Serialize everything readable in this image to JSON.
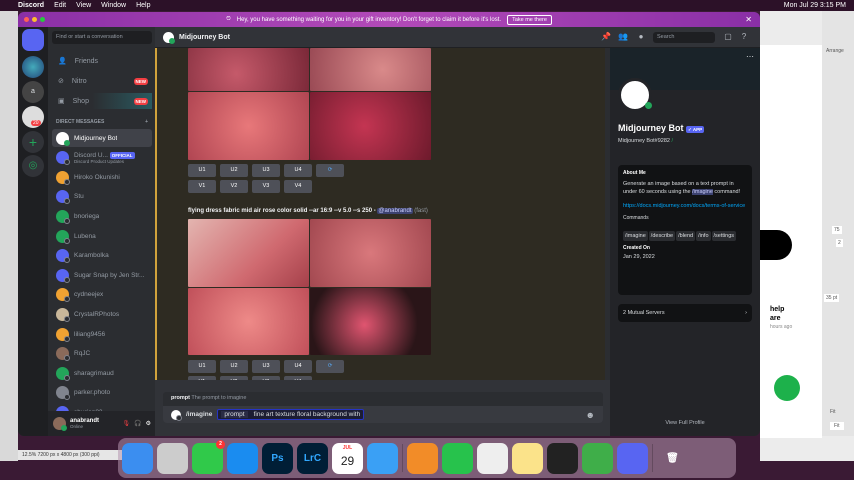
{
  "menubar": {
    "app": "Discord",
    "items": [
      "Edit",
      "View",
      "Window",
      "Help"
    ],
    "clock": "Mon Jul 29  3:15 PM"
  },
  "banner": {
    "text": "Hey, you have something waiting for you in your gift inventory! Don't forget to claim it before it's lost.",
    "button": "Take me there"
  },
  "sidebar": {
    "search_placeholder": "Find or start a conversation",
    "nav": [
      {
        "label": "Friends"
      },
      {
        "label": "Nitro",
        "badge": "NEW"
      },
      {
        "label": "Shop",
        "badge": "NEW"
      }
    ],
    "dm_header": "DIRECT MESSAGES",
    "server_badge": "20",
    "dms": [
      {
        "name": "Midjourney Bot",
        "color": "#ffffff",
        "online": true
      },
      {
        "name": "Discord U...",
        "sub": "Discord Product Updates",
        "badge": "OFFICIAL",
        "color": "#5865f2"
      },
      {
        "name": "Hiroko Okunishi",
        "color": "#f0a232"
      },
      {
        "name": "Stu",
        "color": "#5865f2"
      },
      {
        "name": "bnoriega",
        "color": "#23a55a"
      },
      {
        "name": "Lubena",
        "color": "#23a55a"
      },
      {
        "name": "Karambolka",
        "color": "#5865f2"
      },
      {
        "name": "Sugar Snap by Jen Str...",
        "color": "#5865f2"
      },
      {
        "name": "cydneejex",
        "color": "#f0a232"
      },
      {
        "name": "CrystalRPhotos",
        "color": "#c9b79a"
      },
      {
        "name": "liliang9456",
        "color": "#f0a232"
      },
      {
        "name": "RqJC",
        "color": "#8a6a5a"
      },
      {
        "name": "sharagrimaud",
        "color": "#23a55a"
      },
      {
        "name": "parker.photo",
        "color": "#80848e"
      },
      {
        "name": "shurian82",
        "color": "#5865f2"
      }
    ],
    "user": {
      "name": "anabrandt",
      "status": "Online"
    }
  },
  "header": {
    "title": "Midjourney Bot",
    "search_placeholder": "Search"
  },
  "chat": {
    "buttons_u": [
      "U1",
      "U2",
      "U3",
      "U4"
    ],
    "buttons_v": [
      "V1",
      "V2",
      "V3",
      "V4"
    ],
    "message": {
      "prompt": "flying dress fabric mid air rose color solid --ar 16:9 --v 5.0 --s 250 - ",
      "mention": "@anabrandt",
      "speed": "(fast)"
    }
  },
  "composer": {
    "hint_key": "prompt",
    "hint_text": "The prompt to imagine",
    "command": "/imagine",
    "option": "prompt",
    "value": "fine art texture floral background with"
  },
  "profile": {
    "name": "Midjourney Bot",
    "app_badge": "✓ APP",
    "tag": "Midjourney Bot#9282",
    "slash": "/",
    "about_title": "About Me",
    "about_pre": "Generate an image based on a text prompt in under 60 seconds using the ",
    "about_cmd": "/imagine",
    "about_post": " command!",
    "link": "https://docs.midjourney.com/docs/terms-of-service",
    "commands_title": "Commands",
    "commands": [
      "/imagine",
      "/describe",
      "/blend",
      "/info",
      "/settings"
    ],
    "created_title": "Created On",
    "created": "Jan 29, 2022",
    "mutual": "2 Mutual Servers",
    "full": "View Full Profile"
  },
  "background": {
    "ps_status": "12.5%   7200 px x 4800 px (300 ppi)",
    "right_labels": [
      "Arrange",
      "75",
      "2",
      "35 pt",
      "Fit",
      "Fit"
    ],
    "chat_popup": [
      "help",
      "are",
      "hours ago"
    ]
  },
  "dock": [
    {
      "name": "Finder"
    },
    {
      "name": "Launchpad"
    },
    {
      "name": "Messages",
      "badge": "2"
    },
    {
      "name": "Safari"
    },
    {
      "name": "Ps"
    },
    {
      "name": "LrC"
    },
    {
      "name": "Calendar",
      "month": "JUL",
      "day": "29"
    },
    {
      "name": "Mail"
    },
    {
      "name": "Pages"
    },
    {
      "name": "Numbers"
    },
    {
      "name": "Printer"
    },
    {
      "name": "Notes"
    },
    {
      "name": "Sketch"
    },
    {
      "name": "Camtasia"
    },
    {
      "name": "Discord"
    },
    {
      "name": "Trash"
    }
  ]
}
